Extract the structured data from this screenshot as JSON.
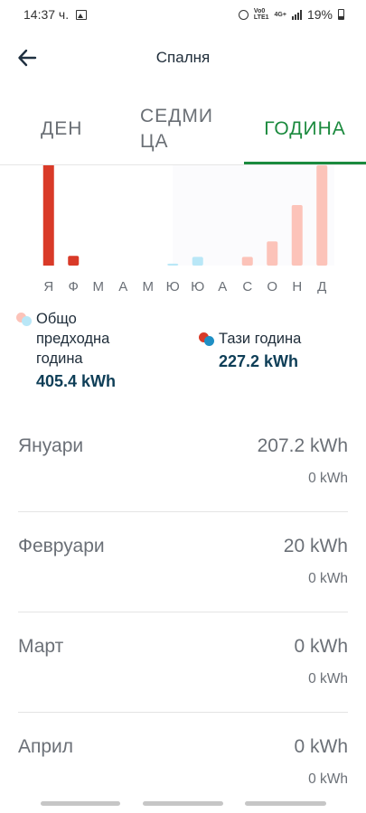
{
  "status_bar": {
    "time": "14:37 ч.",
    "network_top": "Vo0",
    "network_bottom": "LTE1",
    "net_type": "4G+",
    "battery": "19%",
    "icons": [
      "gallery-icon",
      "alarm-icon",
      "signal-icon",
      "battery-icon"
    ]
  },
  "header": {
    "title": "Спалня",
    "back_icon": "arrow-left-icon"
  },
  "tabs": [
    {
      "label": "ДЕН",
      "active": false
    },
    {
      "label": "СЕДМИ\nЦА",
      "active": false
    },
    {
      "label": "ГОДИНА",
      "active": true
    }
  ],
  "colors": {
    "accent": "#1b8a3e",
    "current_year": "#d93a28",
    "previous_year_red": "#fcc3b9",
    "previous_year_blue": "#b9e7f7",
    "current_dot_blue": "#1f8fc4",
    "value_text": "#0e3e57"
  },
  "chart_data": {
    "type": "bar",
    "categories": [
      "Я",
      "Ф",
      "М",
      "А",
      "М",
      "Ю",
      "Ю",
      "А",
      "С",
      "О",
      "Н",
      "Д"
    ],
    "series": [
      {
        "values": [
          207.2,
          20,
          0,
          0,
          0,
          0,
          0,
          0,
          0,
          0,
          0,
          0
        ]
      },
      {
        "values": [
          0,
          0,
          0,
          0,
          0,
          4,
          18,
          0,
          18,
          50,
          125,
          210
        ]
      }
    ],
    "previous_year_bar_colors": [
      "#fcc3b9",
      "#fcc3b9",
      "#fcc3b9",
      "#fcc3b9",
      "#fcc3b9",
      "#b9e7f7",
      "#b9e7f7",
      "#b9e7f7",
      "#fcc3b9",
      "#fcc3b9",
      "#fcc3b9",
      "#fcc3b9"
    ],
    "ylim": [
      0,
      207.2
    ],
    "grid": false
  },
  "legend": {
    "previous": {
      "label": "Общо\nпредходна\nгодина",
      "value": "405.4 kWh"
    },
    "current": {
      "label": "Тази година",
      "value": "227.2 kWh"
    }
  },
  "months": [
    {
      "name": "Януари",
      "current": "207.2 kWh",
      "previous": "0 kWh"
    },
    {
      "name": "Февруари",
      "current": "20 kWh",
      "previous": "0 kWh"
    },
    {
      "name": "Март",
      "current": "0 kWh",
      "previous": "0 kWh"
    },
    {
      "name": "Април",
      "current": "0 kWh",
      "previous": "0 kWh"
    }
  ]
}
